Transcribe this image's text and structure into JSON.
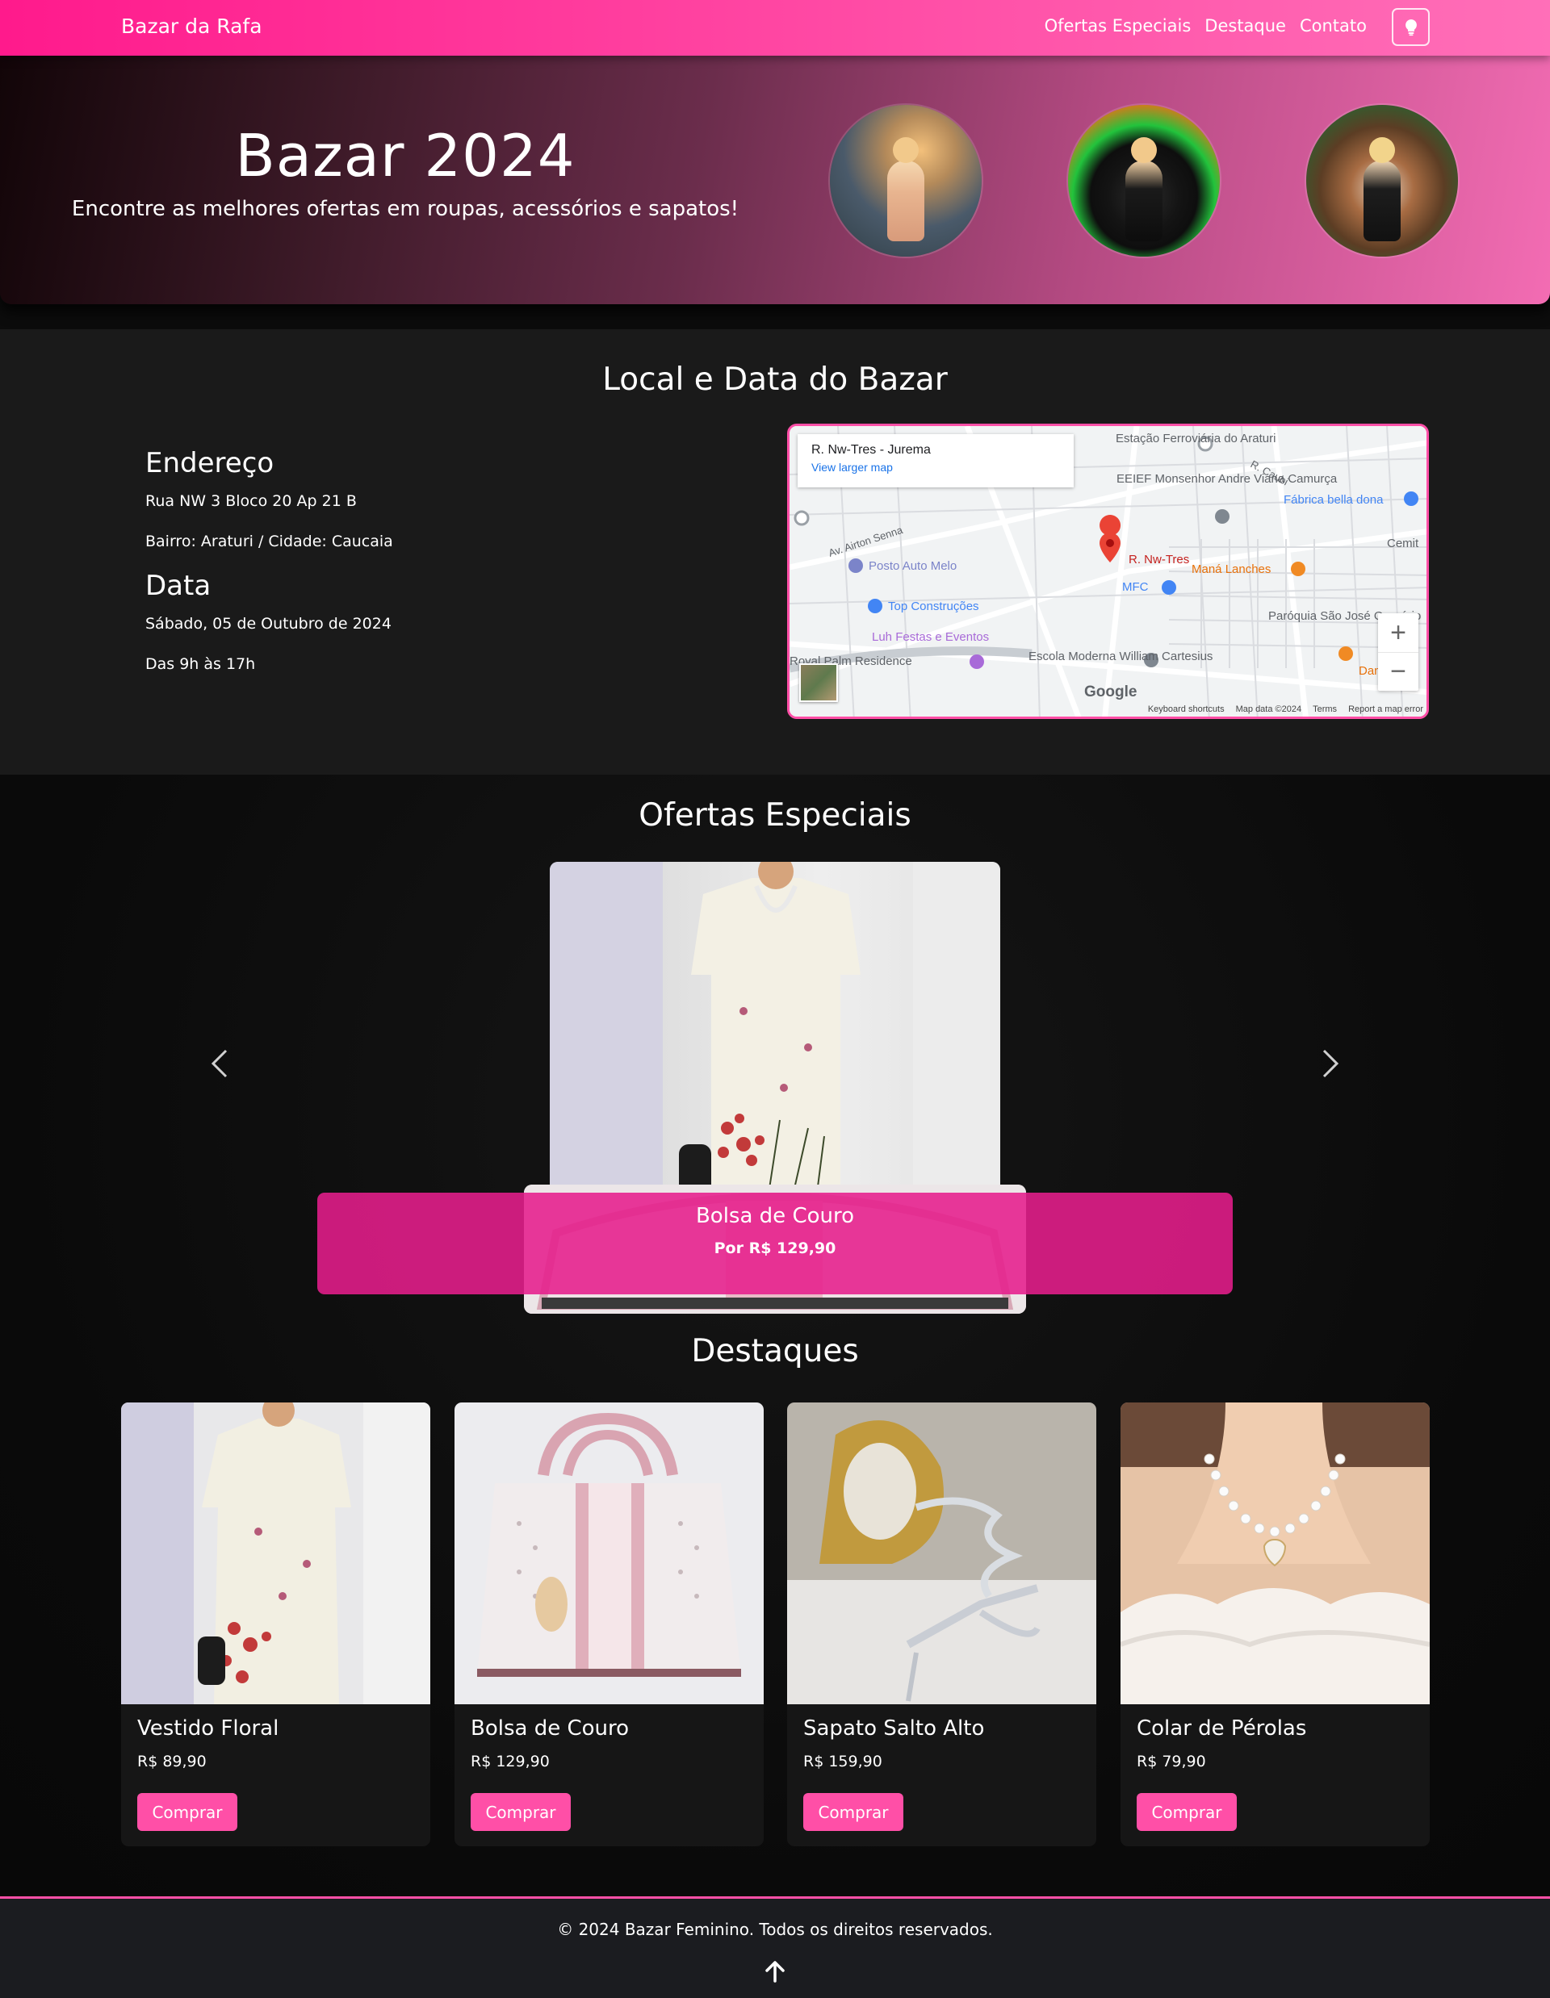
{
  "navbar": {
    "brand": "Bazar da Rafa",
    "links": [
      "Ofertas Especiais",
      "Destaque",
      "Contato"
    ],
    "toggle_icon": "lightbulb-icon",
    "gradient": [
      "#ff1a8c",
      "#ff6fb8"
    ]
  },
  "hero": {
    "title": "Bazar 2024",
    "subtitle": "Encontre as melhores ofertas em roupas, acessórios e sapatos!"
  },
  "location": {
    "title": "Local e Data do Bazar",
    "address_heading": "Endereço",
    "address_line": "Rua NW 3 Bloco 20 Ap 21 B",
    "neighborhood_line": "Bairro: Araturi / Cidade: Caucaia",
    "date_heading": "Data",
    "date_line": "Sábado, 05 de Outubro de 2024",
    "hours_line": "Das 9h às 17h",
    "map": {
      "place_title": "R. Nw-Tres - Jurema",
      "larger_map_link": "View larger map",
      "pin_label": "R. Nw-Tres",
      "labels": {
        "station": "Estação Ferroviária do Araturi",
        "school1": "EEIEF Monsenhor Andre Viana Camurça",
        "shop1": "Fábrica bella dona",
        "gas": "Posto Auto Melo",
        "store": "Top Construções",
        "party": "Luh Festas e Eventos",
        "residence": "Royal Palm Residence",
        "market": "MFC",
        "snack": "Maná Lanches",
        "parish": "Paróquia São José Operário",
        "school2": "Escola Moderna William Cartesius",
        "street1": "Av. Airton Senna",
        "street2": "R. Caubi",
        "cemetery": "Cemit",
        "dan": "Dan"
      },
      "zoom_in": "+",
      "zoom_out": "−",
      "logo": "Google",
      "footer": [
        "Keyboard shortcuts",
        "Map data ©2024",
        "Terms",
        "Report a map error"
      ]
    }
  },
  "offers": {
    "title": "Ofertas Especiais",
    "caption_title": "Bolsa de Couro",
    "caption_price": "Por R$ 129,90",
    "accent": "#ff1a8c"
  },
  "highlights": {
    "title": "Destaques",
    "items": [
      {
        "name": "Vestido Floral",
        "price": "R$ 89,90",
        "button": "Comprar"
      },
      {
        "name": "Bolsa de Couro",
        "price": "R$ 129,90",
        "button": "Comprar"
      },
      {
        "name": "Sapato Salto Alto",
        "price": "R$ 159,90",
        "button": "Comprar"
      },
      {
        "name": "Colar de Pérolas",
        "price": "R$ 79,90",
        "button": "Comprar"
      }
    ],
    "button_color": "#ff4fa7"
  },
  "footer": {
    "text": "© 2024 Bazar Feminino. Todos os direitos reservados.",
    "back_to_top_icon": "arrow-up-icon"
  }
}
